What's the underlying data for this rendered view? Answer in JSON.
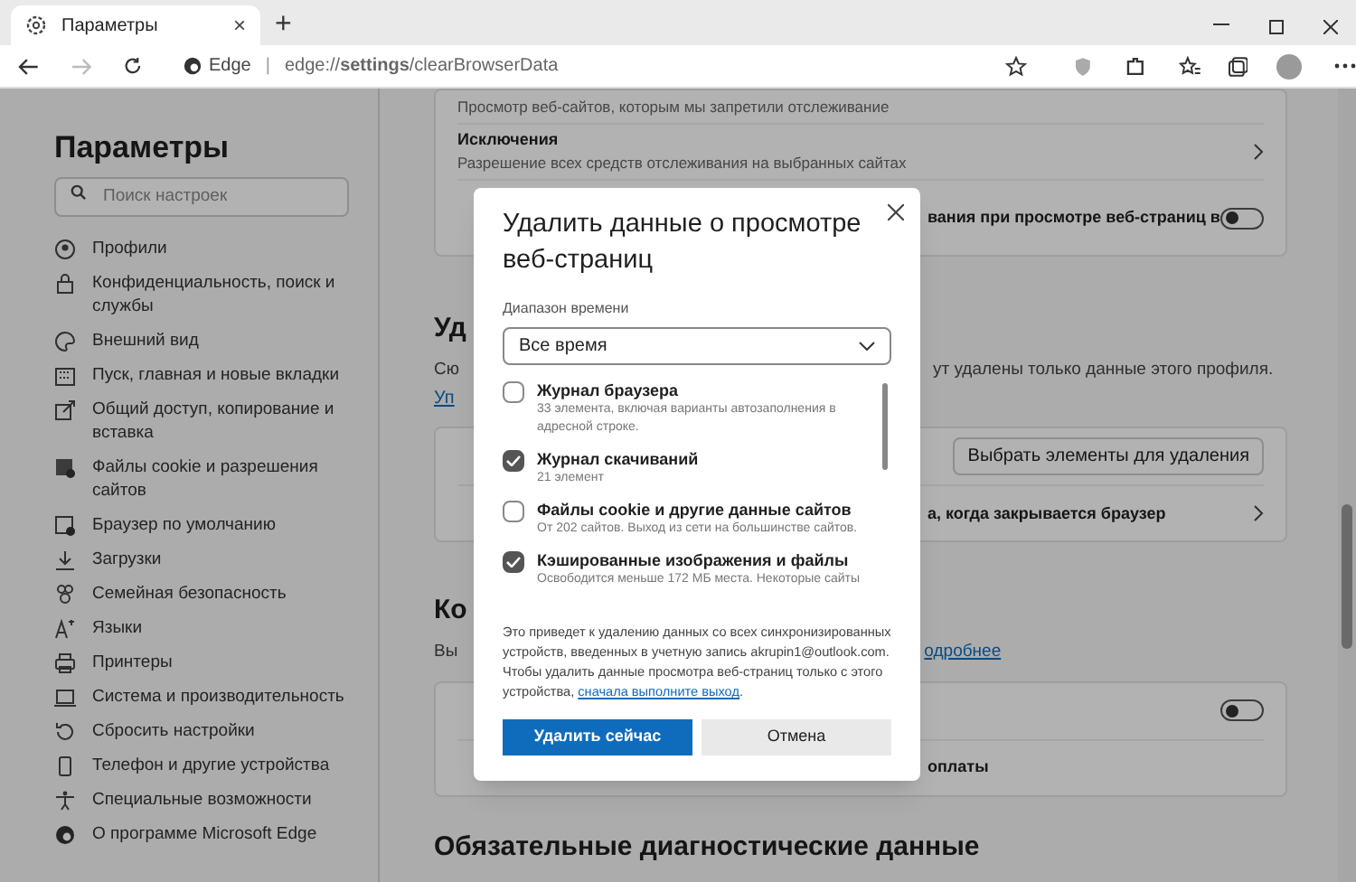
{
  "browser": {
    "tab": {
      "title": "Параметры",
      "close": "×",
      "new_tab": "+"
    },
    "address": {
      "site": "Edge",
      "separator": "|",
      "url": "edge://**settings**/clearBrowserData"
    }
  },
  "sidebar": {
    "title": "Параметры",
    "search": {
      "placeholder": "Поиск настроек"
    },
    "items": [
      {
        "label": "Профили"
      },
      {
        "label": "Конфиденциальность, поиск и службы"
      },
      {
        "label": "Внешний вид"
      },
      {
        "label": "Пуск, главная и новые вкладки"
      },
      {
        "label": "Общий доступ, копирование и вставка"
      },
      {
        "label": "Файлы cookie и разрешения сайтов"
      },
      {
        "label": "Браузер по умолчанию"
      },
      {
        "label": "Загрузки"
      },
      {
        "label": "Семейная безопасность"
      },
      {
        "label": "Языки"
      },
      {
        "label": "Принтеры"
      },
      {
        "label": "Система и производительность"
      },
      {
        "label": "Сбросить настройки"
      },
      {
        "label": "Телефон и другие устройства"
      },
      {
        "label": "Специальные возможности"
      },
      {
        "label": "О программе Microsoft Edge"
      }
    ]
  },
  "content": {
    "blocks": [
      {
        "kind": "card",
        "rows": [
          {
            "kind": "text",
            "detail": "Просмотр веб-сайтов, которым мы запретили отслеживание"
          },
          {
            "kind": "link",
            "label": "Исключения",
            "detail": "Разрешение всех средств отслеживания на выбранных сайтах"
          },
          {
            "kind": "toggle",
            "label": "вания при просмотре веб-страниц в",
            "on": false
          }
        ]
      },
      {
        "kind": "heading",
        "text": "Уд"
      },
      {
        "kind": "description",
        "lead": "Сю",
        "tail": "ут удалены только данные этого профиля.",
        "link": "Уп"
      },
      {
        "kind": "card",
        "rows": [
          {
            "kind": "button",
            "button": "Выбрать элементы для удаления"
          },
          {
            "kind": "link",
            "label": "а, когда закрывается браузер"
          }
        ]
      },
      {
        "kind": "heading",
        "text": "Ко"
      },
      {
        "kind": "description",
        "lead": "Вы",
        "tail_link": "одробнее"
      },
      {
        "kind": "card",
        "rows": [
          {
            "kind": "toggle",
            "on": false
          },
          {
            "kind": "text",
            "label": "оплаты"
          }
        ]
      },
      {
        "kind": "heading",
        "text": "Обязательные диагностические данные"
      }
    ]
  },
  "dialog": {
    "title": "Удалить данные о просмотре веб-страниц",
    "range_label": "Диапазон времени",
    "range": "Все время",
    "items": [
      {
        "label": "Журнал браузера",
        "detail": "33 элемента, включая варианты автозаполнения в адресной строке.",
        "checked": false
      },
      {
        "label": "Журнал скачиваний",
        "detail": "21 элемент",
        "checked": true
      },
      {
        "label": "Файлы cookie и другие данные сайтов",
        "detail": "От 202 сайтов. Выход из сети на большинстве сайтов.",
        "checked": false
      },
      {
        "label": "Кэшированные изображения и файлы",
        "detail": "Освободится меньше 172 МБ места. Некоторые сайты",
        "checked": true
      }
    ],
    "note": {
      "text": "Это приведет к удалению данных со всех синхронизированных устройств, введенных в учетную запись akrupin1@outlook.com. Чтобы удалить данные просмотра веб-страниц только с этого устройства, ",
      "link": "сначала выполните выход",
      "end": "."
    },
    "primary": "Удалить сейчас",
    "secondary": "Отмена"
  }
}
